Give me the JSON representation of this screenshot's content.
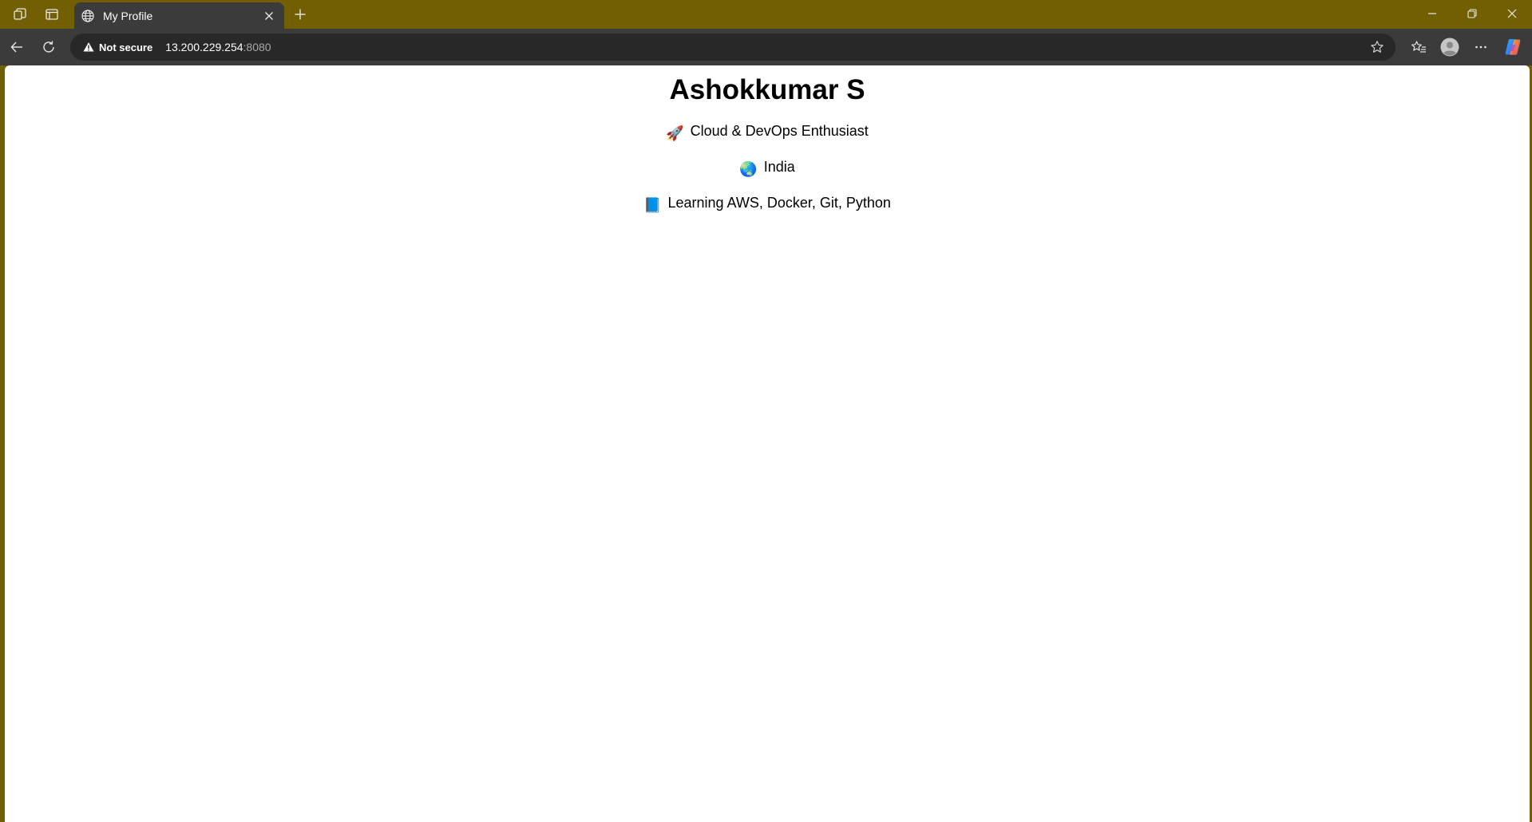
{
  "browser": {
    "tab": {
      "title": "My Profile"
    },
    "address_bar": {
      "security_label": "Not secure",
      "host": "13.200.229.254",
      "port": ":8080"
    },
    "colors": {
      "tabstrip": "#715f02",
      "toolbar": "#3b3b3b",
      "omnibox": "#282828",
      "page_bg": "#ffffff"
    },
    "icons": {
      "workspaces": "workspaces-icon",
      "vertical_tabs": "vertical-tabs-icon",
      "tab_favicon": "globe-icon",
      "tab_close": "close-icon",
      "new_tab": "plus-icon",
      "minimize": "minimize-icon",
      "restore": "restore-icon",
      "close_window": "close-icon",
      "back": "back-arrow-icon",
      "reload": "reload-icon",
      "warning": "warning-icon",
      "favorite": "star-icon",
      "favorites": "favorites-icon",
      "profile": "profile-avatar-icon",
      "menu": "ellipsis-icon",
      "copilot": "copilot-icon"
    }
  },
  "page": {
    "heading": "Ashokkumar S",
    "lines": [
      {
        "emoji": "🚀",
        "text": "Cloud & DevOps Enthusiast"
      },
      {
        "emoji": "🌏",
        "text": "India"
      },
      {
        "emoji": "📘",
        "text": "Learning AWS, Docker, Git, Python"
      }
    ]
  }
}
